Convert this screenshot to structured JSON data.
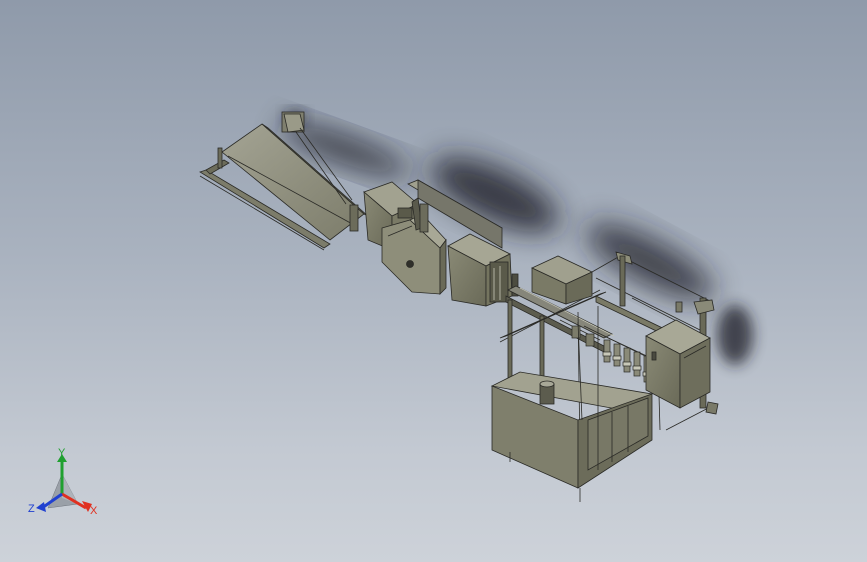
{
  "viewport": {
    "background_top": "#8f9aaa",
    "background_bottom": "#cdd2d9"
  },
  "model": {
    "shadow_color": "#1a1f26",
    "edge_color": "#2a2a26",
    "face_light": "#9a9a88",
    "face_mid": "#85856f",
    "face_dark": "#6c6c5a",
    "components": [
      "conveyor-chute",
      "feed-unit-left",
      "feed-unit-right",
      "press-unit",
      "transfer-rail",
      "clamp-array",
      "frame-structure",
      "control-cabinet",
      "base-cabinet"
    ]
  },
  "triad": {
    "x_label": "X",
    "y_label": "Y",
    "z_label": "Z",
    "x_color": "#e03020",
    "y_color": "#20a030",
    "z_color": "#2040d0"
  }
}
